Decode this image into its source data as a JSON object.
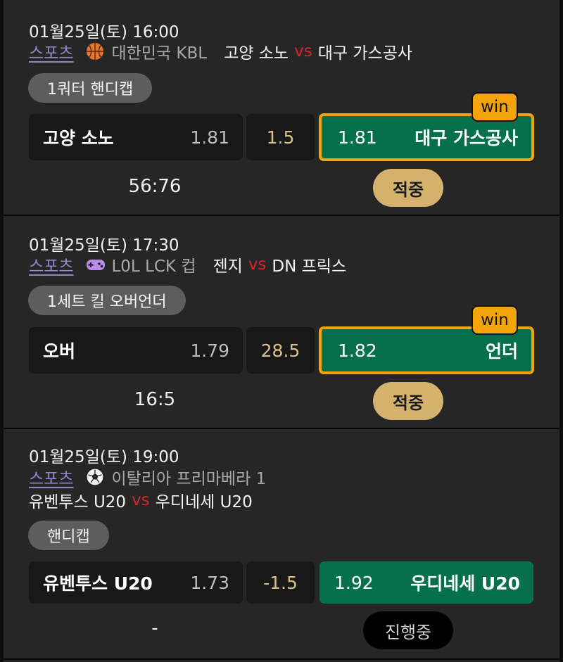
{
  "bets": [
    {
      "datetime": "01월25일(토) 16:00",
      "sports_label": "스포츠",
      "league": "대한민국 KBL",
      "league_icon": "basketball-icon",
      "home_team": "고양 소노",
      "vs_label": "vs",
      "away_team": "대구 가스공사",
      "market": "1쿼터 핸디캡",
      "home_pick": "고양 소노",
      "home_odds": "1.81",
      "line": "1.5",
      "away_odds": "1.81",
      "away_pick": "대구 가스공사",
      "win_badge": "win",
      "score": "56:76",
      "result": "적중"
    },
    {
      "datetime": "01월25일(토) 17:30",
      "sports_label": "스포츠",
      "league": "L0L LCK 컵",
      "league_icon": "gamepad-icon",
      "home_team": "젠지",
      "vs_label": "vs",
      "away_team": "DN 프릭스",
      "market": "1세트 킬 오버언더",
      "home_pick": "오버",
      "home_odds": "1.79",
      "line": "28.5",
      "away_odds": "1.82",
      "away_pick": "언더",
      "win_badge": "win",
      "score": "16:5",
      "result": "적중"
    },
    {
      "datetime": "01월25일(토) 19:00",
      "sports_label": "스포츠",
      "league": "이탈리아 프리마베라 1",
      "league_icon": "soccer-ball-icon",
      "home_team": "유벤투스 U20",
      "vs_label": "vs",
      "away_team": "우디네세 U20",
      "market": "핸디캡",
      "home_pick": "유벤투스 U20",
      "home_odds": "1.73",
      "line": "-1.5",
      "away_odds": "1.92",
      "away_pick": "우디네세 U20",
      "score": "-",
      "result": "진행중"
    }
  ]
}
